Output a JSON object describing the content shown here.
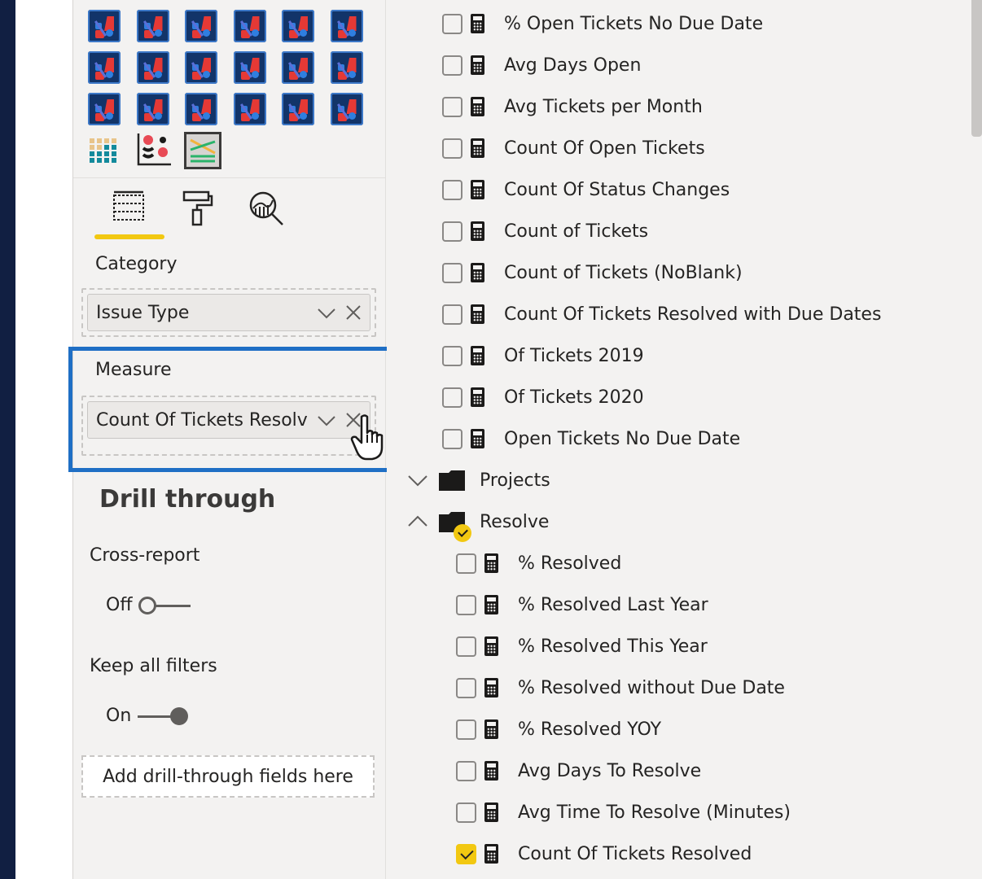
{
  "visualizations": {
    "custom_visual_count": 18,
    "builtin_icons": [
      "matrix-icon",
      "scatter-dots-icon",
      "custom-chart-icon"
    ]
  },
  "pane_tabs": [
    {
      "name": "fields-tab",
      "icon": "fields-icon",
      "active": true
    },
    {
      "name": "format-tab",
      "icon": "paint-roller-icon",
      "active": false
    },
    {
      "name": "analytics-tab",
      "icon": "analytics-magnifier-icon",
      "active": false
    }
  ],
  "wells": {
    "category": {
      "label": "Category",
      "value": "Issue Type"
    },
    "measure": {
      "label": "Measure",
      "value": "Count Of Tickets Resolv"
    }
  },
  "drill_through": {
    "title": "Drill through",
    "cross_report": {
      "label": "Cross-report",
      "state_label": "Off",
      "on": false
    },
    "keep_all_filters": {
      "label": "Keep all filters",
      "state_label": "On",
      "on": true
    },
    "drop_placeholder": "Add drill-through fields here"
  },
  "fields": {
    "top_measures": [
      {
        "label": "% Open Tickets No Due Date",
        "checked": false
      },
      {
        "label": "Avg Days Open",
        "checked": false
      },
      {
        "label": "Avg Tickets per Month",
        "checked": false
      },
      {
        "label": "Count Of Open Tickets",
        "checked": false
      },
      {
        "label": "Count Of Status Changes",
        "checked": false
      },
      {
        "label": "Count of Tickets",
        "checked": false
      },
      {
        "label": "Count of Tickets (NoBlank)",
        "checked": false
      },
      {
        "label": "Count Of Tickets Resolved with Due Dates",
        "checked": false
      },
      {
        "label": "Of Tickets 2019",
        "checked": false
      },
      {
        "label": "Of Tickets 2020",
        "checked": false
      },
      {
        "label": "Open Tickets No Due Date",
        "checked": false
      }
    ],
    "folders": [
      {
        "label": "Projects",
        "expanded": false,
        "has_selection": false
      },
      {
        "label": "Resolve",
        "expanded": true,
        "has_selection": true
      }
    ],
    "resolve_measures": [
      {
        "label": "% Resolved",
        "checked": false
      },
      {
        "label": "% Resolved Last Year",
        "checked": false
      },
      {
        "label": "% Resolved This Year",
        "checked": false
      },
      {
        "label": "% Resolved without Due Date",
        "checked": false
      },
      {
        "label": "% Resolved YOY",
        "checked": false
      },
      {
        "label": "Avg Days To Resolve",
        "checked": false
      },
      {
        "label": "Avg Time To Resolve (Minutes)",
        "checked": false
      },
      {
        "label": "Count Of Tickets Resolved",
        "checked": true
      }
    ]
  },
  "colors": {
    "accent_yellow": "#f2c811",
    "highlight_blue": "#1f6fc5",
    "nav_dark": "#111f42"
  }
}
